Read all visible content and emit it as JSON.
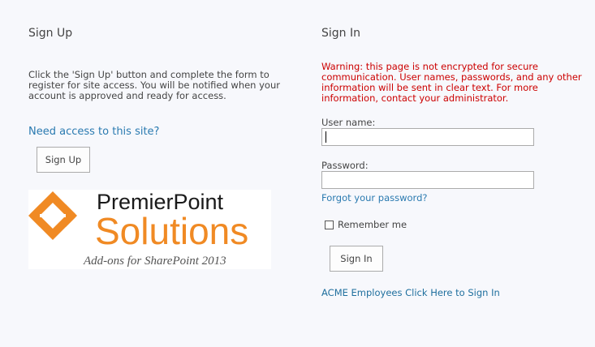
{
  "signup": {
    "title": "Sign Up",
    "description": "Click the 'Sign Up' button and complete the form to register for site access. You will be notified when your account is approved and ready for access.",
    "access_link": "Need access to this site?",
    "button_label": "Sign Up",
    "logo": {
      "brand_top": "PremierPoint",
      "brand_main": "Solutions",
      "tagline": "Add-ons for SharePoint 2013",
      "colors": {
        "orange": "#f08a24",
        "dark": "#1a1a1a",
        "tagline": "#555555"
      }
    }
  },
  "signin": {
    "title": "Sign In",
    "warning": "Warning: this page is not encrypted for secure communication. User names, passwords, and any other information will be sent in clear text. For more information, contact your administrator.",
    "username_label": "User name:",
    "username_value": "",
    "password_label": "Password:",
    "password_value": "",
    "forgot_link": "Forgot your password?",
    "remember_label": "Remember me",
    "remember_checked": false,
    "button_label": "Sign In",
    "acme_link": "ACME Employees Click Here to Sign In"
  },
  "colors": {
    "background": "#f7f8fc",
    "link": "#2a7ab0",
    "warning": "#cc0000",
    "text": "#444444"
  }
}
